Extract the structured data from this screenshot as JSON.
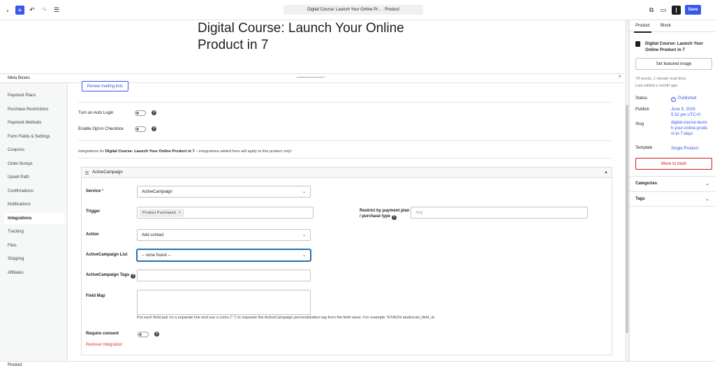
{
  "topbar": {
    "back_icon": "chevron-left-icon",
    "plus_label": "+",
    "undo_icon": "undo-icon",
    "redo_icon": "redo-icon",
    "list_icon": "list-view-icon",
    "document_title": "Digital Course: Launch Your Online Pr... · Product",
    "view_icon": "external-link-icon",
    "preview_icon": "desktop-icon",
    "sidebar_icon": "sidebar-icon",
    "save_label": "Save"
  },
  "post": {
    "title": "Digital Course: Launch Your Online Product in 7"
  },
  "meta_boxes": {
    "label": "Meta Boxes",
    "collapse_glyph": "^"
  },
  "nav": {
    "items": [
      "Payment Plans",
      "Purchase Restrictions",
      "Payment Methods",
      "Form Fields & Settings",
      "Coupons",
      "Order Bumps",
      "Upsell Path",
      "Confirmations",
      "Notifications",
      "Integrations",
      "Tracking",
      "Files",
      "Shipping",
      "Affiliates"
    ],
    "active": "Integrations"
  },
  "content": {
    "renew_button": "Renew mailing lists",
    "auto_login_label": "Turn on Auto Login",
    "opt_in_label": "Enable Opt-in Checkbox",
    "intro_prefix": "Integrations for ",
    "intro_product": "Digital Course: Launch Your Online Product in 7",
    "intro_suffix": " – integrations added here will apply to this product only!",
    "panel": {
      "title": "ActiveCampaign",
      "collapse_glyph": "▲",
      "service_label": "Service",
      "required_mark": "*",
      "service_value": "ActiveCampaign",
      "trigger_label": "Trigger",
      "trigger_token": "Product Purchased",
      "token_remove": "×",
      "restrict_label_1": "Restrict by payment plan",
      "restrict_label_2": "/ purchase type",
      "restrict_placeholder": "Any",
      "action_label": "Action",
      "action_value": "Add contact",
      "list_label": "ActiveCampaign List",
      "list_value": "-- none found --",
      "tags_label": "ActiveCampaign Tags",
      "field_map_label": "Field Map",
      "field_map_note": "Put each field pair on a separate line and use a colon (\":\") to separate the ActiveCampaign personalization tag from the field value. For example: %TAG%:studiocart_field_id",
      "consent_label": "Require consent",
      "remove_link": "Remove Integration"
    },
    "help_glyph": "?",
    "chevron_glyph": "⌄"
  },
  "statusbar": {
    "label": "Product"
  },
  "right_sidebar": {
    "tabs": [
      "Product",
      "Block"
    ],
    "active_tab": "Product",
    "post_title": "Digital Course: Launch Your Online Product in 7",
    "featured_button": "Set featured image",
    "word_count": "79 words, 1 minute read time.",
    "last_edited": "Last edited a month ago.",
    "status_key": "Status",
    "status_value": "Published",
    "status_icon": "check-circle-icon",
    "publish_key": "Publish",
    "publish_value_1": "June 5, 2026",
    "publish_value_2": "5:32 pm UTC+0",
    "slug_key": "Slug",
    "slug_value": "digital-course-launch-your-online-product-in-7-days",
    "template_key": "Template",
    "template_value": "Single Product",
    "trash_button": "Move to trash",
    "categories_label": "Categories",
    "tags_label": "Tags",
    "section_chevron": "⌄"
  }
}
